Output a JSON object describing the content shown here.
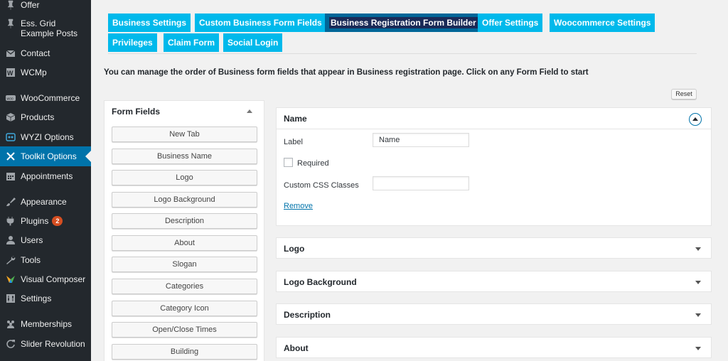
{
  "sidebar": {
    "items": [
      {
        "label": "Offer",
        "icon": "pin-icon"
      },
      {
        "label": "Ess. Grid Example Posts",
        "icon": "pin-icon"
      },
      {
        "label": "Contact",
        "icon": "envelope-icon"
      },
      {
        "label": "WCMp",
        "icon": "wcmp-icon"
      },
      {
        "label": "WooCommerce",
        "icon": "woo-icon"
      },
      {
        "label": "Products",
        "icon": "box-icon"
      },
      {
        "label": "WYZI Options",
        "icon": "wyzi-icon"
      },
      {
        "label": "Toolkit Options",
        "icon": "tools-icon",
        "active": true
      },
      {
        "label": "Appointments",
        "icon": "calendar-icon"
      },
      {
        "label": "Appearance",
        "icon": "brush-icon"
      },
      {
        "label": "Plugins",
        "icon": "plug-icon",
        "badge": "2"
      },
      {
        "label": "Users",
        "icon": "user-icon"
      },
      {
        "label": "Tools",
        "icon": "wrench-icon"
      },
      {
        "label": "Visual Composer",
        "icon": "vc-icon"
      },
      {
        "label": "Settings",
        "icon": "settings-icon"
      },
      {
        "label": "Memberships",
        "icon": "group-icon"
      },
      {
        "label": "Slider Revolution",
        "icon": "refresh-icon"
      }
    ],
    "colors": {
      "bg": "#23282d",
      "active": "#0073aa",
      "badge": "#d54e21"
    }
  },
  "tabs": [
    {
      "label": "Business Settings"
    },
    {
      "label": "Custom Business Form Fields"
    },
    {
      "label": "Business Registration Form Builder",
      "active": true
    },
    {
      "label": "Offer Settings"
    },
    {
      "label": "Woocommerce Settings"
    },
    {
      "label": "Privileges"
    },
    {
      "label": "Claim Form"
    },
    {
      "label": "Social Login"
    }
  ],
  "tab_colors": {
    "normal": "#00b9eb",
    "active": "#006799"
  },
  "intro_text": "You can manage the order of Business form fields that appear in Business registration page. Click on any Form Field to start",
  "reset_label": "Reset",
  "form_fields": {
    "title": "Form Fields",
    "items": [
      "New Tab",
      "Business Name",
      "Logo",
      "Logo Background",
      "Description",
      "About",
      "Slogan",
      "Categories",
      "Category Icon",
      "Open/Close Times",
      "Building"
    ]
  },
  "builder": {
    "name_panel": {
      "title": "Name",
      "label_caption": "Label",
      "label_value": "Name",
      "required_caption": "Required",
      "css_caption": "Custom CSS Classes",
      "css_value": "",
      "remove_label": "Remove"
    },
    "collapsed": [
      "Logo",
      "Logo Background",
      "Description",
      "About"
    ]
  }
}
